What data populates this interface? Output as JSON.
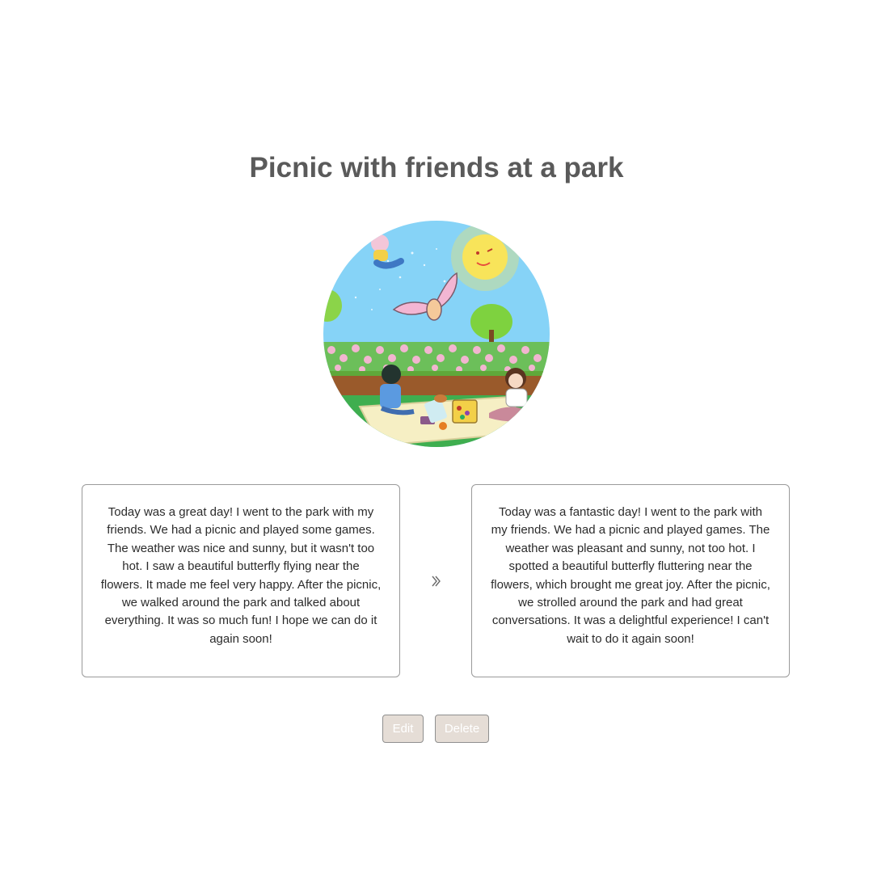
{
  "entry": {
    "title": "Picnic with friends at a park",
    "original_text": "Today was a great day! I went to the park with my friends. We had a picnic and played some games. The weather was nice and sunny, but it wasn't too hot. I saw a beautiful butterfly flying near the flowers. It made me feel very happy. After the picnic, we walked around the park and talked about everything. It was so much fun! I hope we can do it again soon!",
    "revised_text": "Today was a fantastic day! I went to the park with my friends. We had a picnic and played games. The weather was pleasant and sunny, not too hot. I spotted a beautiful butterfly fluttering near the flowers, which brought me great joy. After the picnic, we strolled around the park and had great conversations. It was a delightful experience! I can't wait to do it again soon!"
  },
  "illustration": {
    "icon": "picnic-illustration",
    "colors": {
      "sky": "#86d3f7",
      "sun": "#f8e45a",
      "grass": "#3fae4f",
      "blanket": "#f6efc4",
      "bench": "#9a5a2b",
      "flowers": "#f2b5d0"
    }
  },
  "divider_icon": "double-chevron-right-icon",
  "actions": {
    "edit_label": "Edit",
    "delete_label": "Delete"
  },
  "theme": {
    "button_bg": "#e5ddd6",
    "title_color": "#5a5a5a"
  }
}
